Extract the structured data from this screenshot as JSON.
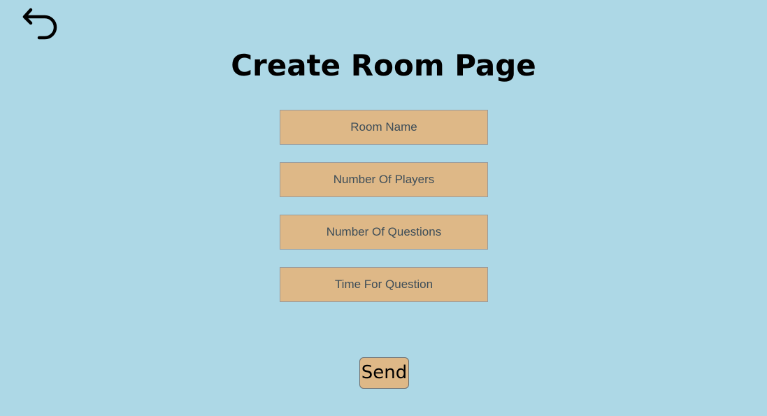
{
  "header": {
    "back_icon": "undo-arrow-icon",
    "title": "Create Room Page"
  },
  "form": {
    "fields": [
      {
        "placeholder": "Room Name",
        "value": ""
      },
      {
        "placeholder": "Number Of Players",
        "value": ""
      },
      {
        "placeholder": "Number Of Questions",
        "value": ""
      },
      {
        "placeholder": "Time For Question",
        "value": ""
      }
    ],
    "submit_label": "Send"
  },
  "colors": {
    "background": "#add8e6",
    "field_background": "#deb887",
    "field_border": "#9a9a9a",
    "placeholder_text": "#3d4d58",
    "title_text": "#000000"
  }
}
